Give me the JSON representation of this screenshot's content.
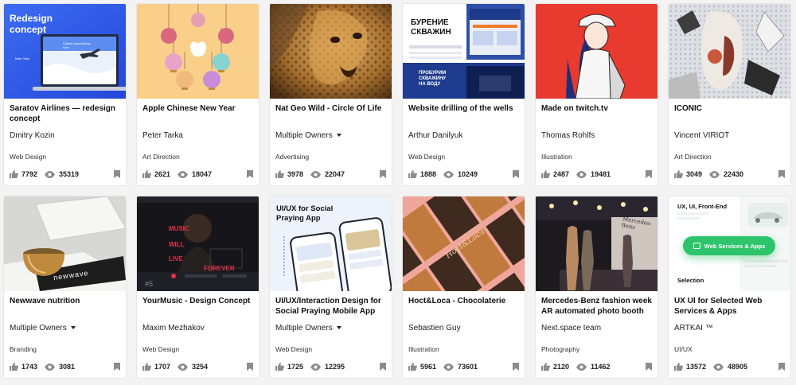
{
  "projects": [
    {
      "title": "Saratov Airlines — redesign concept",
      "owner": "Dmitry Kozin",
      "multi": false,
      "category": "Web Design",
      "likes": "7792",
      "views": "35319",
      "thumb_text": {
        "t1": "Redesign",
        "t2": "concept",
        "t3": "Main Task",
        "t4": "Collect impressions now"
      }
    },
    {
      "title": "Apple Chinese New Year",
      "owner": "Peter Tarka",
      "multi": false,
      "category": "Art Direction",
      "likes": "2621",
      "views": "18047"
    },
    {
      "title": "Nat Geo Wild - Circle Of Life",
      "owner": "Multiple Owners",
      "multi": true,
      "category": "Advertising",
      "likes": "3978",
      "views": "22047"
    },
    {
      "title": "Website drilling of the wells",
      "owner": "Arthur Danilyuk",
      "multi": false,
      "category": "Web Design",
      "likes": "1888",
      "views": "10249",
      "thumb_text": {
        "t1": "БУРЕНИЕ",
        "t2": "СКВАЖИН",
        "t3": "ПРОБУРИМ",
        "t4": "СКВАЖИНУ",
        "t5": "НА ВОДУ"
      }
    },
    {
      "title": "Made on twitch.tv",
      "owner": "Thomas Rohlfs",
      "multi": false,
      "category": "Illustration",
      "likes": "2487",
      "views": "19481"
    },
    {
      "title": "ICONIC",
      "owner": "Vincent VIRIOT",
      "multi": false,
      "category": "Art Direction",
      "likes": "3049",
      "views": "22430"
    },
    {
      "title": "Newwave nutrition",
      "owner": "Multiple Owners",
      "multi": true,
      "category": "Branding",
      "likes": "1743",
      "views": "3081",
      "thumb_text": {
        "t1": "newwave"
      }
    },
    {
      "title": "YourMusic - Design Concept",
      "owner": "Maxim Mezhakov",
      "multi": false,
      "category": "Web Design",
      "likes": "1707",
      "views": "3254",
      "thumb_text": {
        "t1": "MUSIC",
        "t2": "WILL",
        "t3": "LIVE",
        "t4": "FOREVER",
        "t5": "#5"
      }
    },
    {
      "title": "UI/UX/Interaction Design for Social Praying Mobile App",
      "owner": "Multiple Owners",
      "multi": true,
      "category": "Web Design",
      "likes": "1725",
      "views": "12295",
      "thumb_text": {
        "t1": "UI/UX for Social",
        "t2": "Praying App"
      }
    },
    {
      "title": "Hoct&Loca - Chocolaterie",
      "owner": "Sebastien Guy",
      "multi": false,
      "category": "Illustration",
      "likes": "5961",
      "views": "73601",
      "thumb_text": {
        "t1": "Hoct&Loca"
      }
    },
    {
      "title": "Mercedes-Benz fashion week AR automated photo booth",
      "owner": "Next.space team",
      "multi": false,
      "category": "Photography",
      "likes": "2120",
      "views": "11462",
      "thumb_text": {
        "t1": "Mercedes-Benz"
      }
    },
    {
      "title": "UX UI for Selected Web Services & Apps",
      "owner": "ARTKAI ™",
      "multi": false,
      "category": "UI/UX",
      "likes": "13572",
      "views": "48905",
      "thumb_text": {
        "t1": "UX, UI, Front-End",
        "t2": "Web Services & Apps",
        "t3": "Selection"
      }
    }
  ],
  "icons": {
    "like": "thumbs-up-icon",
    "views": "eye-icon",
    "save": "bookmark-icon",
    "caret": "chevron-down-icon"
  },
  "colors": {
    "background": "#f3f3f3",
    "card": "#ffffff",
    "stat_icon": "#8c8c8c",
    "accent_green": "#2ec46b",
    "accent_blue": "#2f6df0"
  }
}
